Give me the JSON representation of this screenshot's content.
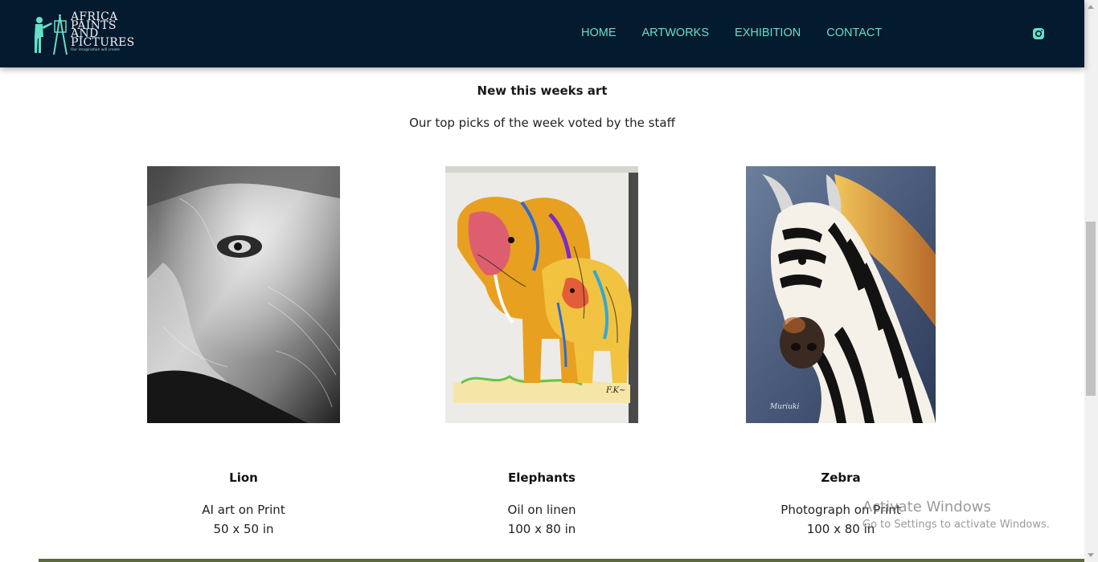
{
  "header": {
    "logo_lines": [
      "AFRICA",
      "PAINTS",
      "AND",
      "PICTURES"
    ],
    "logo_tagline": "Our imagination will create",
    "nav": [
      {
        "label": "HOME"
      },
      {
        "label": "ARTWORKS"
      },
      {
        "label": "EXHIBITION"
      },
      {
        "label": "CONTACT"
      }
    ],
    "social_icon": "instagram-icon",
    "colors": {
      "background": "#041a2f",
      "accent": "#66e0c7"
    }
  },
  "section": {
    "title": "New this weeks art",
    "subtitle": "Our top picks of the week voted by the staff"
  },
  "artworks": [
    {
      "title": "Lion",
      "medium": "AI art on Print",
      "size": "50 x 50 in",
      "image": "lion-artwork"
    },
    {
      "title": "Elephants",
      "medium": "Oil on linen",
      "size": "100 x 80 in",
      "image": "elephants-artwork"
    },
    {
      "title": "Zebra",
      "medium": "Photograph on Print",
      "size": "100 x 80 in",
      "image": "zebra-artwork"
    }
  ],
  "watermark": {
    "title": "Activate Windows",
    "subtitle": "Go to Settings to activate Windows."
  }
}
